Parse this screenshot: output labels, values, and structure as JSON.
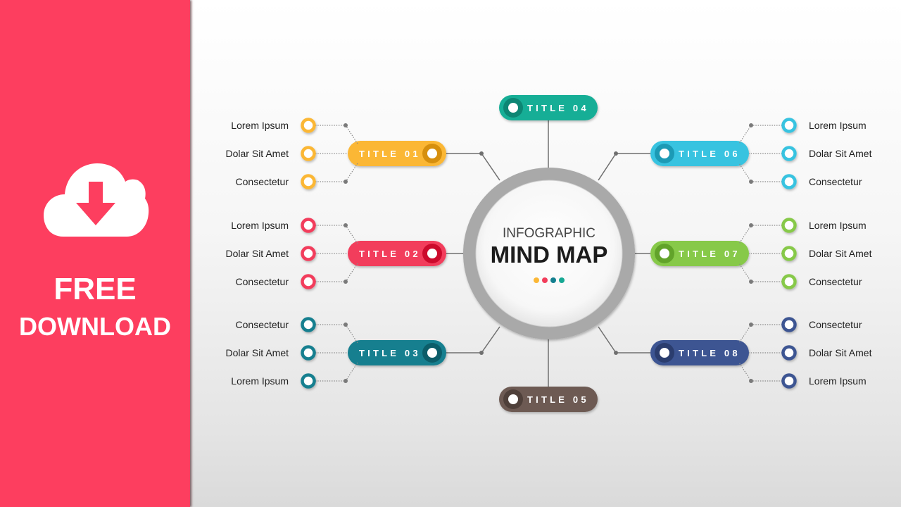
{
  "banner": {
    "icon": "cloud-download-icon",
    "line1": "FREE",
    "line2": "DOWNLOAD",
    "color": "#fd3e5f"
  },
  "center": {
    "line1": "INFOGRAPHIC",
    "line2": "MIND MAP",
    "dots": [
      "#fbb735",
      "#f23d5b",
      "#137f8f",
      "#16a893"
    ],
    "ring_color": "#a9a9a9"
  },
  "nodes": [
    {
      "id": "01",
      "title": "TITLE 01",
      "color": "#fbb735",
      "dark": "#d68f0e",
      "side": "left",
      "items": [
        "Lorem Ipsum",
        "Dolar Sit Amet",
        "Consectetur"
      ]
    },
    {
      "id": "02",
      "title": "TITLE 02",
      "color": "#f23d5b",
      "dark": "#cc0a2c",
      "side": "left",
      "items": [
        "Lorem Ipsum",
        "Dolar Sit Amet",
        "Consectetur"
      ]
    },
    {
      "id": "03",
      "title": "TITLE 03",
      "color": "#137f8f",
      "dark": "#0c5d69",
      "side": "left",
      "items": [
        "Consectetur",
        "Dolar Sit Amet",
        "Lorem Ipsum"
      ]
    },
    {
      "id": "04",
      "title": "TITLE 04",
      "color": "#16ae96",
      "dark": "#0d8674",
      "side": "top",
      "items": []
    },
    {
      "id": "05",
      "title": "TITLE 05",
      "color": "#6d5a52",
      "dark": "#4f403a",
      "side": "bottom",
      "items": []
    },
    {
      "id": "06",
      "title": "TITLE 06",
      "color": "#38c3e0",
      "dark": "#1c9ab5",
      "side": "right",
      "items": [
        "Lorem Ipsum",
        "Dolar Sit Amet",
        "Consectetur"
      ]
    },
    {
      "id": "07",
      "title": "TITLE 07",
      "color": "#87c94a",
      "dark": "#62a32a",
      "side": "right",
      "items": [
        "Lorem Ipsum",
        "Dolar Sit Amet",
        "Consectetur"
      ]
    },
    {
      "id": "08",
      "title": "TITLE 08",
      "color": "#3e5592",
      "dark": "#2b3d6e",
      "side": "right",
      "items": [
        "Consectetur",
        "Dolar Sit Amet",
        "Lorem Ipsum"
      ]
    }
  ]
}
